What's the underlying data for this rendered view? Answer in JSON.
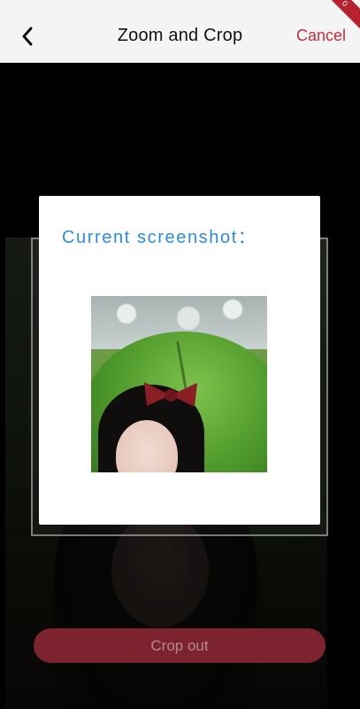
{
  "header": {
    "title": "Zoom and Crop",
    "cancel_label": "Cancel",
    "back_icon": "chevron-left-icon",
    "corner_badge": "0"
  },
  "modal": {
    "heading": "Current screenshot："
  },
  "actions": {
    "crop_label": "Crop out"
  },
  "colors": {
    "accent_red": "#c22f3b",
    "crop_button": "#7d2330",
    "modal_heading": "#2d8bde"
  }
}
